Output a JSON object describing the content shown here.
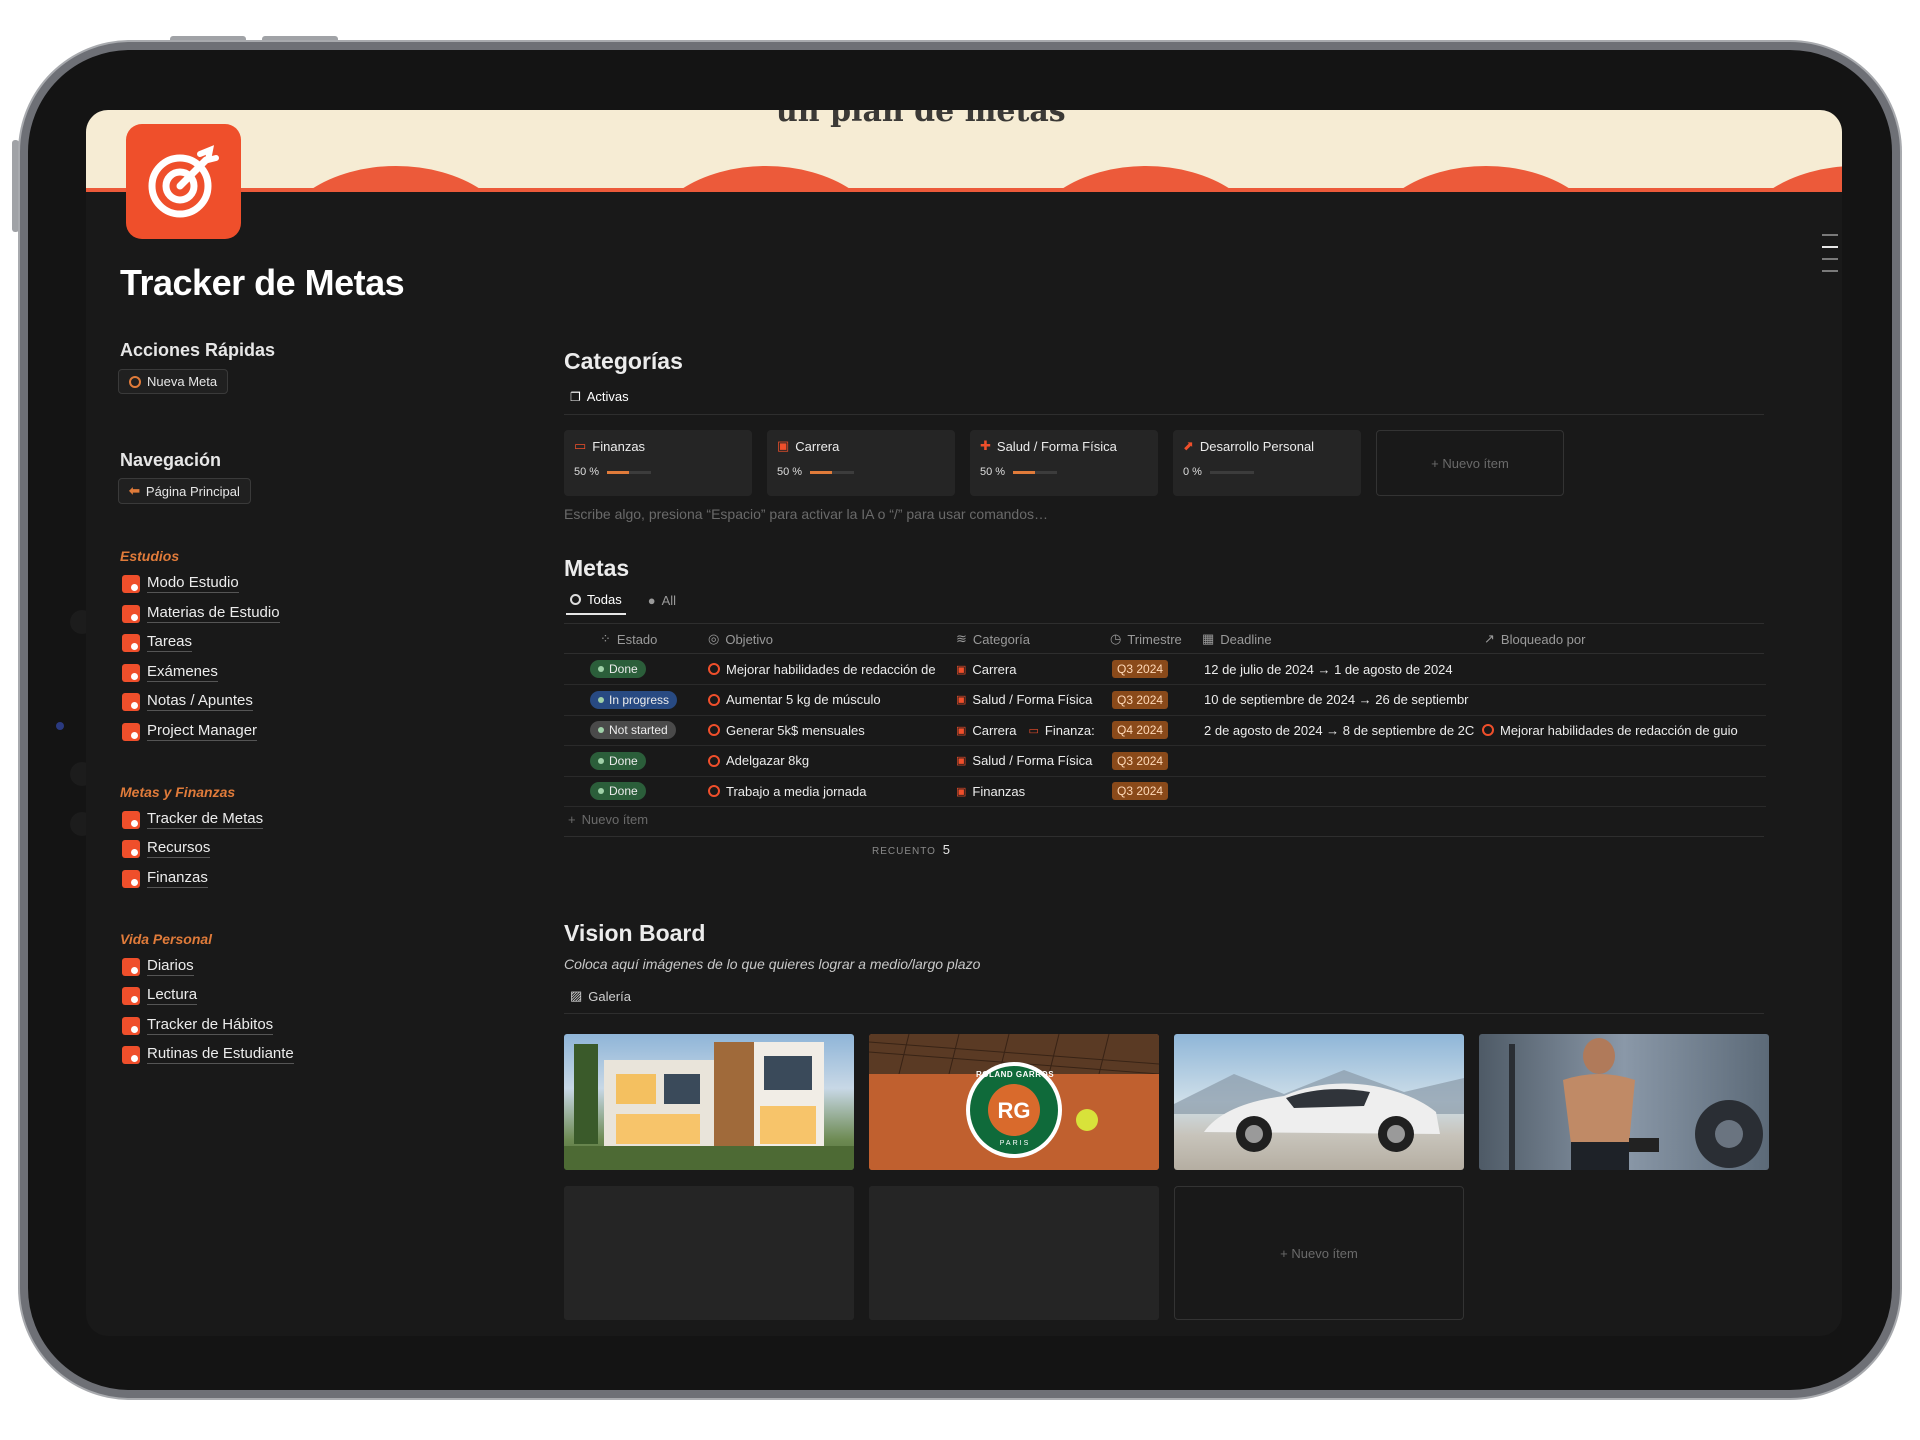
{
  "banner_text": "un plan de metas",
  "page": {
    "title": "Tracker de Metas",
    "accent": "#ef4f2b"
  },
  "left": {
    "quick_actions": {
      "heading": "Acciones Rápidas",
      "button": "Nueva Meta"
    },
    "navigation": {
      "heading": "Navegación",
      "button": "Página Principal"
    },
    "groups": [
      {
        "heading": "Estudios",
        "items": [
          "Modo Estudio",
          "Materias de Estudio",
          "Tareas",
          "Exámenes",
          "Notas / Apuntes",
          "Project Manager"
        ]
      },
      {
        "heading": "Metas y Finanzas",
        "items": [
          "Tracker de Metas",
          "Recursos",
          "Finanzas"
        ]
      },
      {
        "heading": "Vida Personal",
        "items": [
          "Diarios",
          "Lectura",
          "Tracker de Hábitos",
          "Rutinas de Estudiante"
        ]
      }
    ]
  },
  "categorias": {
    "heading": "Categorías",
    "view": "Activas",
    "cards": [
      {
        "name": "Finanzas",
        "pct_label": "50 %",
        "progress": 0.5
      },
      {
        "name": "Carrera",
        "pct_label": "50 %",
        "progress": 0.5
      },
      {
        "name": "Salud / Forma Física",
        "pct_label": "50 %",
        "progress": 0.5
      },
      {
        "name": "Desarrollo Personal",
        "pct_label": "0 %",
        "progress": 0
      }
    ],
    "new_item": "+ Nuevo ítem",
    "hint": "Escribe algo, presiona “Espacio” para activar la IA o “/” para usar comandos…"
  },
  "metas": {
    "heading": "Metas",
    "tabs": [
      "Todas",
      "All"
    ],
    "columns": [
      "Estado",
      "Objetivo",
      "Categoría",
      "Trimestre",
      "Deadline",
      "Bloqueado por"
    ],
    "rows": [
      {
        "estado": "Done",
        "objetivo": "Mejorar habilidades de redacción de",
        "categoria": "Carrera",
        "categoria2": "",
        "trimestre": "Q3 2024",
        "deadline": "12 de julio de 2024 → 1 de agosto de 2024",
        "bloqueado": ""
      },
      {
        "estado": "In progress",
        "objetivo": "Aumentar 5 kg de músculo",
        "categoria": "Salud / Forma Física",
        "categoria2": "",
        "trimestre": "Q3 2024",
        "deadline": "10 de septiembre de 2024 → 26 de septiembr",
        "bloqueado": ""
      },
      {
        "estado": "Not started",
        "objetivo": "Generar 5k$ mensuales",
        "categoria": "Carrera",
        "categoria2": "Finanza:",
        "trimestre": "Q4 2024",
        "deadline": "2 de agosto de 2024 → 8 de septiembre de 2C",
        "bloqueado": "Mejorar habilidades de redacción de guio"
      },
      {
        "estado": "Done",
        "objetivo": "Adelgazar 8kg",
        "categoria": "Salud / Forma Física",
        "categoria2": "",
        "trimestre": "Q3 2024",
        "deadline": "",
        "bloqueado": ""
      },
      {
        "estado": "Done",
        "objetivo": "Trabajo a media jornada",
        "categoria": "Finanzas",
        "categoria2": "",
        "trimestre": "Q3 2024",
        "deadline": "",
        "bloqueado": ""
      }
    ],
    "new_item": "Nuevo ítem",
    "count_label": "RECUENTO",
    "count": "5",
    "status_colors": {
      "Done": "#2b5e3a",
      "In progress": "#284a82",
      "Not started": "#4a4a4a"
    }
  },
  "vision": {
    "heading": "Vision Board",
    "subtitle": "Coloca aquí imágenes de lo que quieres lograr a medio/largo plazo",
    "view": "Galería",
    "logo_text": "ROLAND GARROS",
    "logo_sub": "PARIS",
    "new_item": "+ Nuevo ítem"
  }
}
